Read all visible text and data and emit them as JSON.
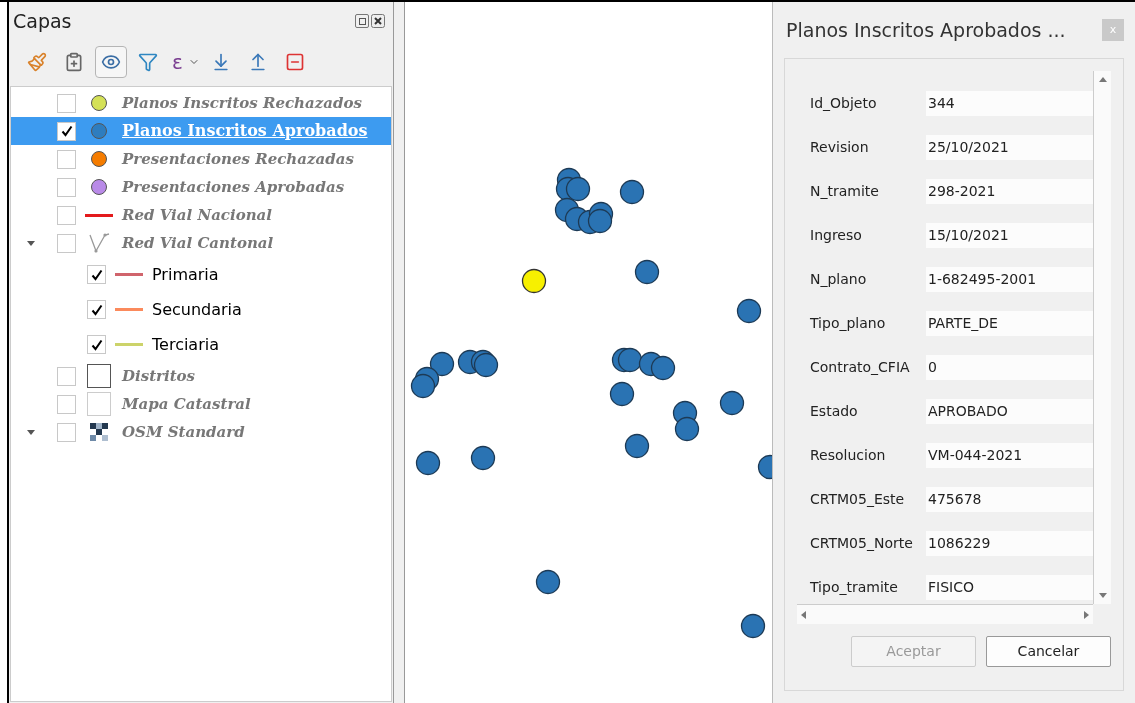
{
  "layers_panel": {
    "title": "Capas",
    "toolbar": [
      {
        "kind": "style",
        "pressed": false
      },
      {
        "kind": "add-group",
        "pressed": false
      },
      {
        "kind": "visibility",
        "pressed": true
      },
      {
        "kind": "filter",
        "pressed": false
      },
      {
        "kind": "expression",
        "glyph": "ε",
        "pressed": false
      },
      {
        "kind": "expand",
        "pressed": false
      },
      {
        "kind": "collapse",
        "pressed": false
      },
      {
        "kind": "remove",
        "pressed": false
      }
    ],
    "layers": [
      {
        "name": "Planos Inscritos Rechazados",
        "kind": "point",
        "color": "#d4e157",
        "checked": false,
        "selected": false
      },
      {
        "name": "Planos Inscritos Aprobados",
        "kind": "point",
        "color": "#2e7dbf",
        "checked": true,
        "selected": true
      },
      {
        "name": "Presentaciones Rechazadas",
        "kind": "point",
        "color": "#f57c00",
        "checked": false,
        "selected": false
      },
      {
        "name": "Presentaciones Aprobadas",
        "kind": "point",
        "color": "#b98ae8",
        "checked": false,
        "selected": false
      },
      {
        "name": "Red Vial Nacional",
        "kind": "line",
        "color": "#e31a1c",
        "checked": false,
        "selected": false
      },
      {
        "name": "Red Vial Cantonal",
        "kind": "categorized",
        "checked": false,
        "selected": false,
        "expanded": true,
        "children": [
          {
            "name": "Primaria",
            "kind": "line",
            "color": "#d0646c",
            "checked": true,
            "selected": false
          },
          {
            "name": "Secundaria",
            "kind": "line",
            "color": "#fb8a5c",
            "checked": true,
            "selected": false
          },
          {
            "name": "Terciaria",
            "kind": "line",
            "color": "#ccd36a",
            "checked": true,
            "selected": false
          }
        ]
      },
      {
        "name": "Distritos",
        "kind": "polygon",
        "color": "#555555",
        "checked": false,
        "selected": false
      },
      {
        "name": "Mapa Catastral",
        "kind": "polygon",
        "color": "#cccccc",
        "checked": false,
        "selected": false
      },
      {
        "name": "OSM Standard",
        "kind": "raster",
        "checked": false,
        "selected": false,
        "expanded": true
      }
    ]
  },
  "dialog": {
    "title": "Planos Inscritos Aprobados ...",
    "close": "x",
    "fields": [
      {
        "label": "Id_Objeto",
        "value": "344"
      },
      {
        "label": "Revision",
        "value": "25/10/2021"
      },
      {
        "label": "N_tramite",
        "value": "298-2021"
      },
      {
        "label": "Ingreso",
        "value": "15/10/2021"
      },
      {
        "label": "N_plano",
        "value": "1-682495-2001"
      },
      {
        "label": "Tipo_plano",
        "value": "PARTE_DE"
      },
      {
        "label": "Contrato_CFIA",
        "value": "0"
      },
      {
        "label": "Estado",
        "value": "APROBADO"
      },
      {
        "label": "Resolucion",
        "value": "VM-044-2021"
      },
      {
        "label": "CRTM05_Este",
        "value": "475678"
      },
      {
        "label": "CRTM05_Norte",
        "value": "1086229"
      },
      {
        "label": "Tipo_tramite",
        "value": "FISICO"
      }
    ],
    "buttons": [
      {
        "label": "Aceptar",
        "disabled": true
      },
      {
        "label": "Cancelar",
        "disabled": false
      }
    ]
  }
}
